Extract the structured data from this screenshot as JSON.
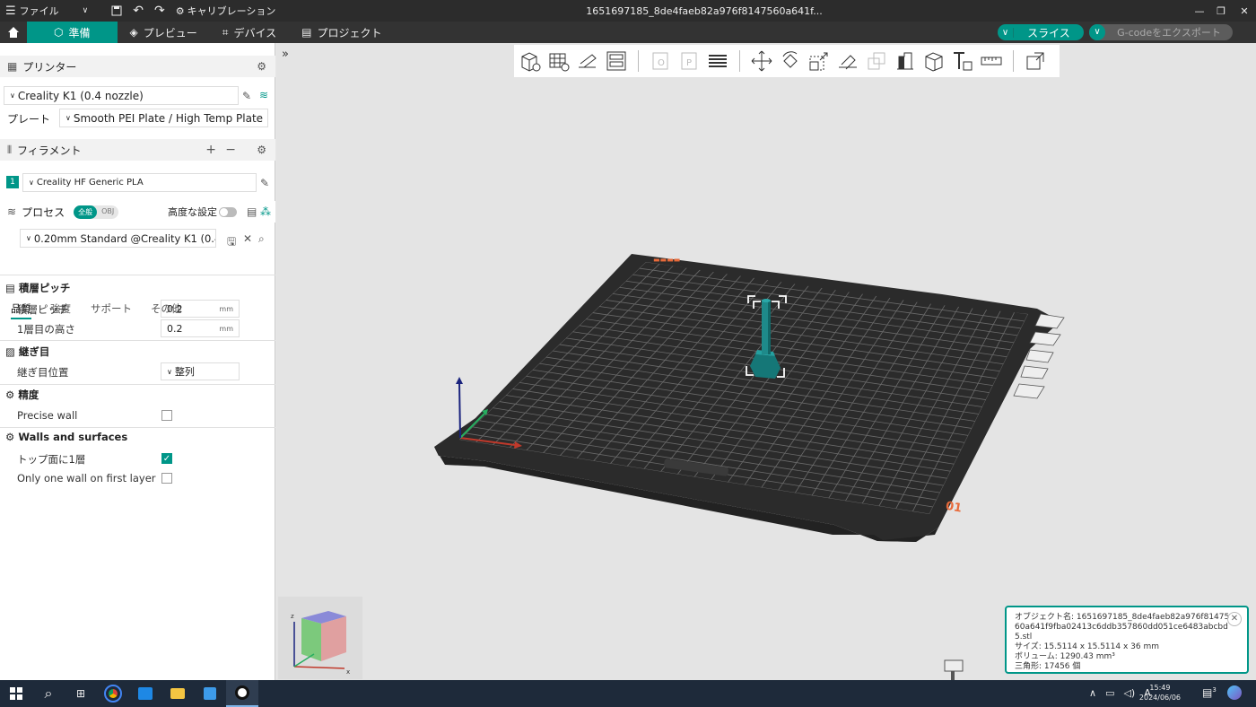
{
  "window": {
    "menu_label": "ファイル",
    "calibration_label": "キャリブレーション",
    "title": "1651697185_8de4faeb82a976f8147560a641f..."
  },
  "tabs": {
    "prepare": "準備",
    "preview": "プレビュー",
    "device": "デバイス",
    "project": "プロジェクト"
  },
  "actions": {
    "slice": "スライス",
    "export": "G-codeをエクスポート"
  },
  "printer": {
    "section_title": "プリンター",
    "selected": "Creality K1 (0.4 nozzle)",
    "plate_label": "プレート",
    "plate_value": "Smooth PEI Plate / High Temp Plate"
  },
  "filament": {
    "section_title": "フィラメント",
    "slot": "1",
    "selected": "Creality HF Generic PLA"
  },
  "process": {
    "section_title": "プロセス",
    "toggle_global": "全般",
    "toggle_obj": "OBJ",
    "advanced_label": "高度な設定",
    "preset": "0.20mm Standard @Creality K1 (0.4 n...",
    "subtabs": [
      "品質",
      "強度",
      "サポート",
      "その他"
    ]
  },
  "settings": {
    "layer_group": "積層ピッチ",
    "layer_height_label": "積層ピッチ",
    "layer_height_value": "0.2",
    "first_layer_label": "1層目の高さ",
    "first_layer_value": "0.2",
    "unit": "mm",
    "seam_group": "継ぎ目",
    "seam_pos_label": "継ぎ目位置",
    "seam_pos_value": "整列",
    "precision_group": "精度",
    "precise_wall_label": "Precise wall",
    "precise_wall_checked": false,
    "walls_group": "Walls and surfaces",
    "top_one_wall_label": "トップ面に1層",
    "top_one_wall_checked": true,
    "first_layer_one_wall_label": "Only one wall on first layer",
    "first_layer_one_wall_checked": false
  },
  "object_info": {
    "name_line1": "オブジェクト名: 1651697185_8de4faeb82a976f81475",
    "name_line2": "60a641f9fba02413c6ddb357860dd051ce6483abcbd",
    "name_line3": "5.stl",
    "size": "サイズ: 15.5114 x 15.5114 x 36 mm",
    "volume": "ボリューム: 1290.43 mm³",
    "triangles": "三角形: 17456 個"
  },
  "bed": {
    "plate_number": "01"
  },
  "taskbar": {
    "time": "15:49",
    "date": "2024/06/06",
    "ime": "A",
    "notify_count": "3"
  },
  "colors": {
    "accent": "#009688",
    "bed_plate": "#2b2b2b",
    "grid_line": "#6b6b6b",
    "model": "#1e8a8a",
    "plate_number": "#e86a3a"
  }
}
